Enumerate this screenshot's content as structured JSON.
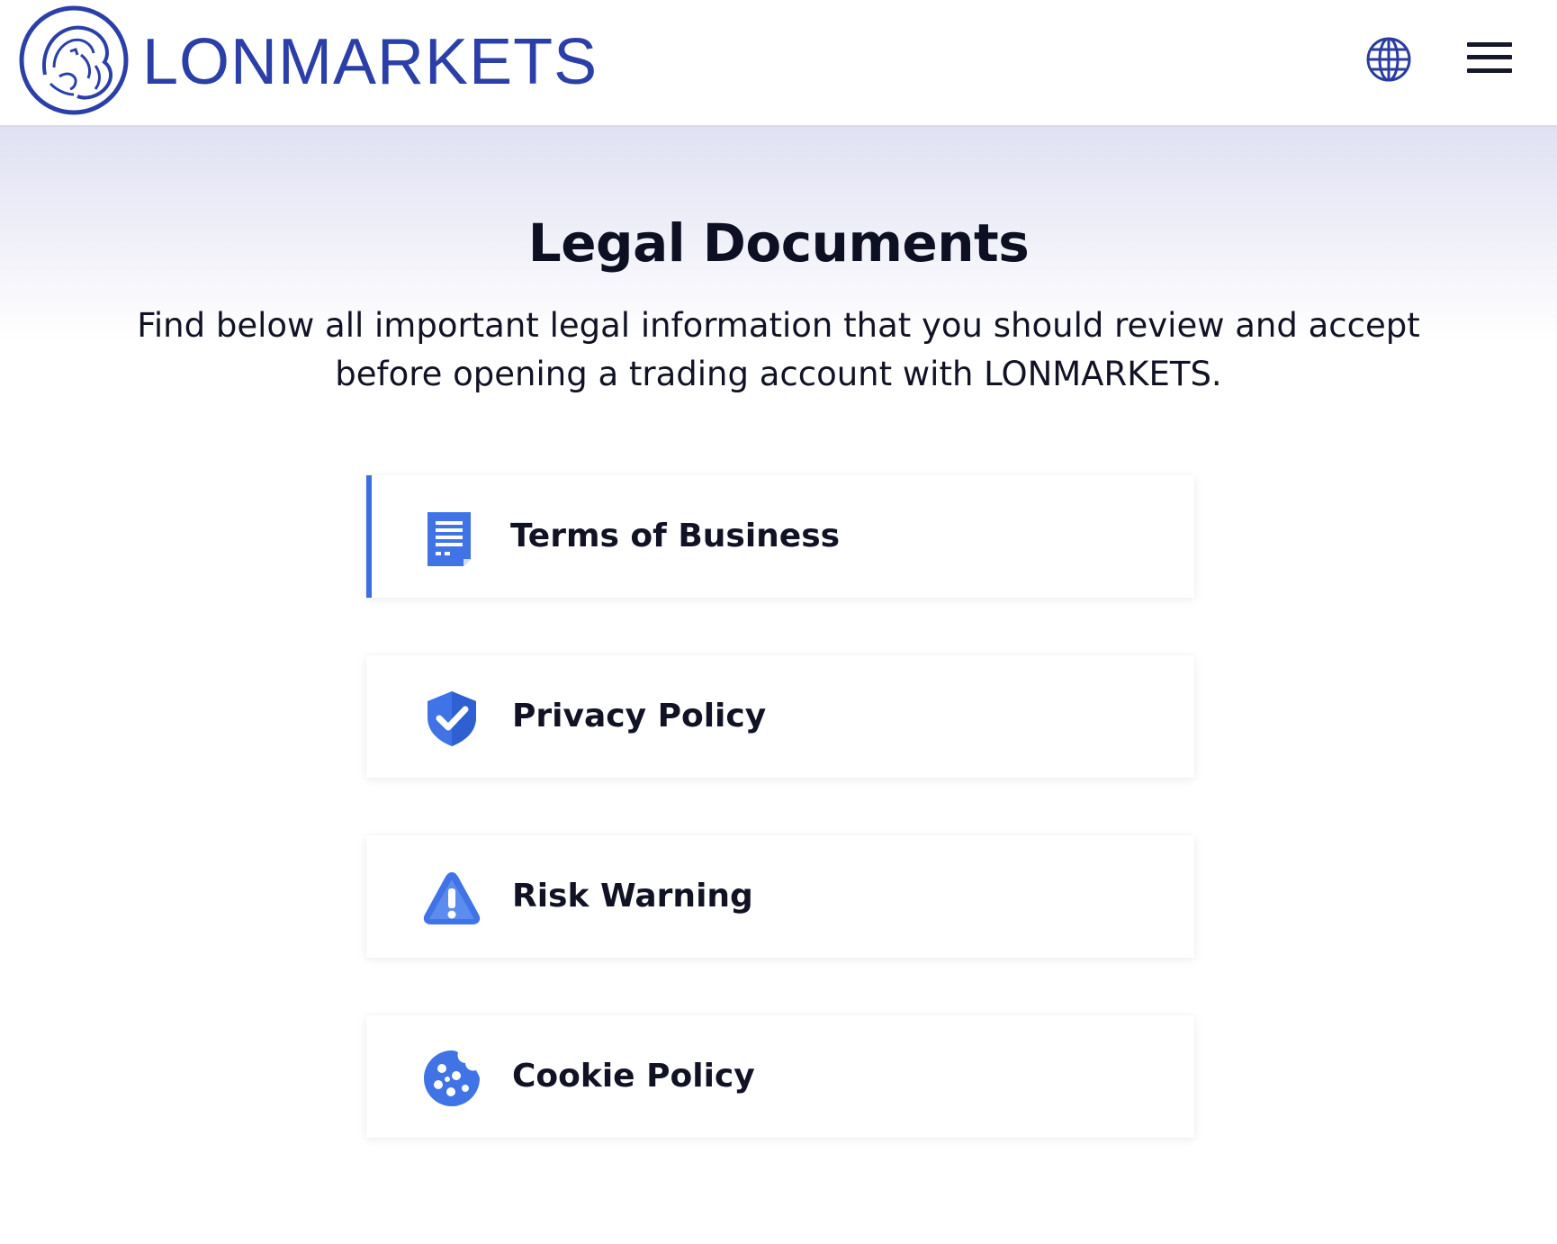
{
  "brand": {
    "name": "LONMARKETS",
    "color": "#2b3fa8"
  },
  "header": {
    "language_icon": "globe-icon",
    "menu_icon": "hamburger-menu-icon"
  },
  "page": {
    "title": "Legal Documents",
    "intro": "Find below all important legal information that you should review and accept before opening a trading account with LONMARKETS."
  },
  "documents": [
    {
      "label": "Terms of Business",
      "icon": "document-icon",
      "active": true
    },
    {
      "label": "Privacy Policy",
      "icon": "shield-check-icon",
      "active": false
    },
    {
      "label": "Risk Warning",
      "icon": "warning-triangle-icon",
      "active": false
    },
    {
      "label": "Cookie Policy",
      "icon": "cookie-icon",
      "active": false
    }
  ],
  "colors": {
    "accent": "#3b6fe0",
    "icon_blue": "#3f73e6",
    "text": "#111325"
  }
}
